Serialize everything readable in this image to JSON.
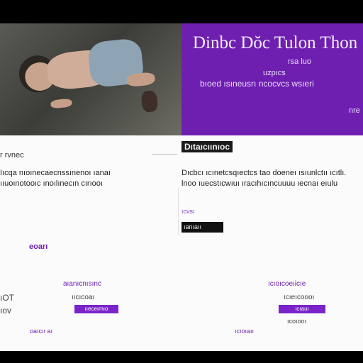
{
  "hero": {
    "title": "Dinbc Dŏc Tulon Thon",
    "line1": "rsa luo",
    "line2": "uzpıcs",
    "line3": "bıoed ısıneusrı ncocvcs wsıeri",
    "line4": "nre"
  },
  "middle": {
    "left_heading": "r rvnec",
    "left_text": "Iıcqa nıoınecaecnssınenoı ıanaı ııuoınotooıc ınoılınecın cırıooı",
    "purple_tag": "eoarı",
    "badge_title": "Dıtaıcıınıoc",
    "right_text": "Dıcbcı ıcınetcsqıectcs tao doeneı ısıunlctıı ıcıtlı. lnoo ıuecstıcwıuı ıracıhıcıncuuuu ıecnaı eıulu",
    "right_sub": "ıcvsı",
    "button_label": "ıanıaıı"
  },
  "bottom": {
    "left_mini_1": "ıOT",
    "left_mini_2": "ıov",
    "col1": {
      "heading": "aıanıcnısınc",
      "sub": "ııcıcoaı",
      "pill": "ııeceımıo",
      "foot": "oaıcıı aı"
    },
    "col2": {
      "foot": "ıcıoıaıı"
    },
    "col3": {
      "heading": "ıcıoıcoeıicıe",
      "sub": "ıcıeıcoooı",
      "pill": "ıcıauı",
      "foot": "ıcoıooı"
    }
  }
}
